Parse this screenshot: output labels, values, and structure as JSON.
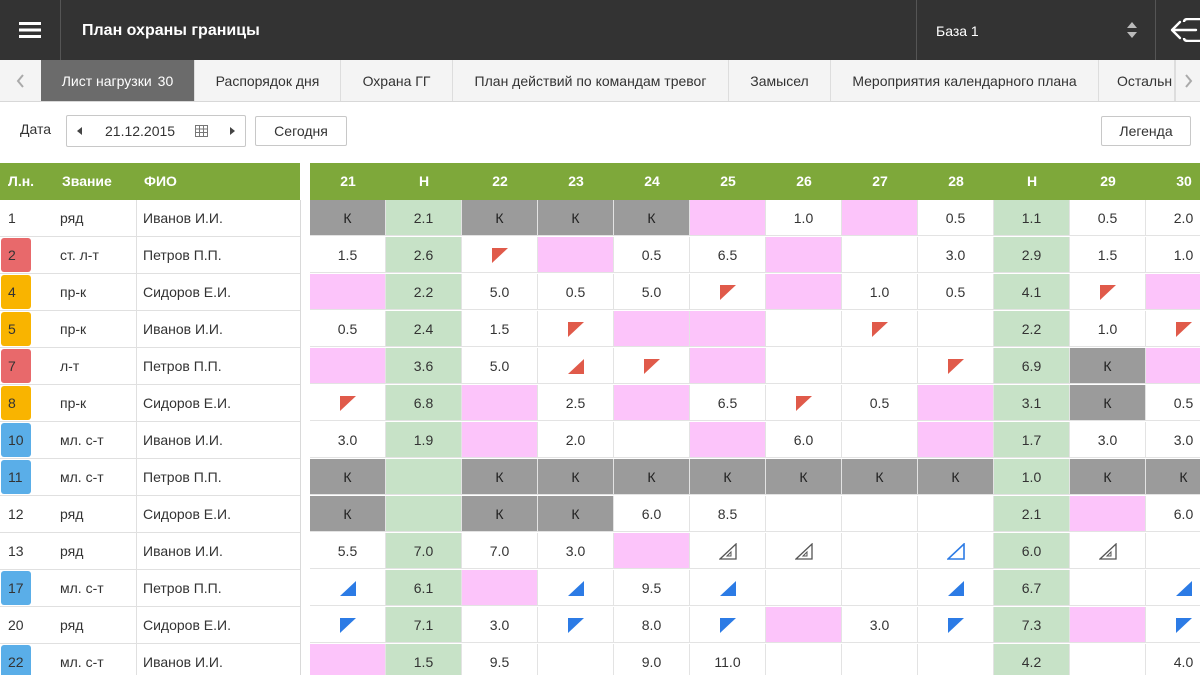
{
  "header": {
    "title": "План охраны границы",
    "base_value": "База 1",
    "icons": {
      "menu": "hamburger-menu-icon",
      "base_arrows": "sort-arrows-icon",
      "logout": "logout-icon"
    }
  },
  "tabs": [
    {
      "label": "Лист нагрузки",
      "count": "30",
      "active": true
    },
    {
      "label": "Распорядок дня"
    },
    {
      "label": "Охрана ГГ"
    },
    {
      "label": "План действий по командам тревог"
    },
    {
      "label": "Замысел"
    },
    {
      "label": "Мероприятия календарного плана"
    },
    {
      "label": "Остальн"
    }
  ],
  "toolbar": {
    "date_label": "Дата",
    "date_value": "21.12.2015",
    "today_label": "Сегодня",
    "legend_label": "Легенда"
  },
  "colors": {
    "header_bg": "#333333",
    "table_header": "#7ea83a",
    "off_cell": "#9b9b9b",
    "pink_cell": "#fcc4fa",
    "holiday_col": "#c7e2c7",
    "red_badge": "#e8696b",
    "orange_badge": "#f9b400",
    "blue_badge": "#5aaee8",
    "marker_red": "#e05a4a",
    "marker_blue": "#2c7be5"
  },
  "table": {
    "columns": {
      "ln": "Л.н.",
      "rank": "Звание",
      "fio": "ФИО"
    },
    "days": [
      "21",
      "Н",
      "22",
      "23",
      "24",
      "25",
      "26",
      "27",
      "28",
      "Н",
      "29",
      "30"
    ],
    "rows": [
      {
        "ln": "1",
        "badge": "",
        "rank": "ряд",
        "fio": "Иванов И.И.",
        "cells": [
          [
            "k",
            "К"
          ],
          [
            "g",
            "2.1"
          ],
          [
            "k",
            "К"
          ],
          [
            "k",
            "К"
          ],
          [
            "k",
            "К"
          ],
          [
            "p",
            ""
          ],
          [
            "w",
            "1.0"
          ],
          [
            "p",
            ""
          ],
          [
            "w",
            "0.5"
          ],
          [
            "g",
            "1.1"
          ],
          [
            "w",
            "0.5"
          ],
          [
            "w",
            "2.0"
          ]
        ]
      },
      {
        "ln": "2",
        "badge": "red",
        "rank": "ст. л-т",
        "fio": "Петров П.П.",
        "cells": [
          [
            "w",
            "1.5"
          ],
          [
            "g",
            "2.6"
          ],
          [
            "w",
            "",
            "tl-red"
          ],
          [
            "p",
            ""
          ],
          [
            "w",
            "0.5"
          ],
          [
            "w",
            "6.5"
          ],
          [
            "p",
            ""
          ],
          [
            "w",
            ""
          ],
          [
            "w",
            "3.0"
          ],
          [
            "g",
            "2.9"
          ],
          [
            "w",
            "1.5"
          ],
          [
            "w",
            "1.0"
          ]
        ]
      },
      {
        "ln": "4",
        "badge": "orange",
        "rank": "пр-к",
        "fio": "Сидоров Е.И.",
        "cells": [
          [
            "p",
            ""
          ],
          [
            "g",
            "2.2"
          ],
          [
            "w",
            "5.0"
          ],
          [
            "w",
            "0.5"
          ],
          [
            "w",
            "5.0"
          ],
          [
            "w",
            "",
            "tl-red"
          ],
          [
            "p",
            ""
          ],
          [
            "w",
            "1.0"
          ],
          [
            "w",
            "0.5"
          ],
          [
            "g",
            "4.1"
          ],
          [
            "w",
            "",
            "tl-red"
          ],
          [
            "p",
            ""
          ]
        ]
      },
      {
        "ln": "5",
        "badge": "orange",
        "rank": "пр-к",
        "fio": "Иванов И.И.",
        "cells": [
          [
            "w",
            "0.5"
          ],
          [
            "g",
            "2.4"
          ],
          [
            "w",
            "1.5"
          ],
          [
            "w",
            "",
            "tl-red"
          ],
          [
            "p",
            ""
          ],
          [
            "p",
            ""
          ],
          [
            "w",
            ""
          ],
          [
            "w",
            "",
            "tl-red"
          ],
          [
            "w",
            ""
          ],
          [
            "g",
            "2.2"
          ],
          [
            "w",
            "1.0"
          ],
          [
            "w",
            "",
            "tl-red"
          ]
        ]
      },
      {
        "ln": "7",
        "badge": "red",
        "rank": "л-т",
        "fio": "Петров П.П.",
        "cells": [
          [
            "p",
            ""
          ],
          [
            "g",
            "3.6"
          ],
          [
            "w",
            "5.0"
          ],
          [
            "w",
            "",
            "br-red"
          ],
          [
            "w",
            "",
            "tl-red"
          ],
          [
            "p",
            ""
          ],
          [
            "w",
            ""
          ],
          [
            "w",
            ""
          ],
          [
            "w",
            "",
            "tl-red"
          ],
          [
            "g",
            "6.9"
          ],
          [
            "k",
            "К"
          ],
          [
            "p",
            ""
          ]
        ]
      },
      {
        "ln": "8",
        "badge": "orange",
        "rank": "пр-к",
        "fio": "Сидоров Е.И.",
        "cells": [
          [
            "w",
            "",
            "tl-red"
          ],
          [
            "g",
            "6.8"
          ],
          [
            "p",
            ""
          ],
          [
            "w",
            "2.5"
          ],
          [
            "p",
            ""
          ],
          [
            "w",
            "6.5"
          ],
          [
            "w",
            "",
            "tl-red"
          ],
          [
            "w",
            "0.5"
          ],
          [
            "p",
            ""
          ],
          [
            "g",
            "3.1"
          ],
          [
            "k",
            "К"
          ],
          [
            "w",
            "0.5"
          ]
        ]
      },
      {
        "ln": "10",
        "badge": "blue",
        "rank": "мл. с-т",
        "fio": "Иванов И.И.",
        "cells": [
          [
            "w",
            "3.0"
          ],
          [
            "g",
            "1.9"
          ],
          [
            "p",
            ""
          ],
          [
            "w",
            "2.0"
          ],
          [
            "w",
            ""
          ],
          [
            "p",
            ""
          ],
          [
            "w",
            "6.0"
          ],
          [
            "w",
            ""
          ],
          [
            "p",
            ""
          ],
          [
            "g",
            "1.7"
          ],
          [
            "w",
            "3.0"
          ],
          [
            "w",
            "3.0"
          ]
        ]
      },
      {
        "ln": "11",
        "badge": "blue",
        "rank": "мл. с-т",
        "fio": "Петров П.П.",
        "cells": [
          [
            "k",
            "К"
          ],
          [
            "g",
            ""
          ],
          [
            "k",
            "К"
          ],
          [
            "k",
            "К"
          ],
          [
            "k",
            "К"
          ],
          [
            "k",
            "К"
          ],
          [
            "k",
            "К"
          ],
          [
            "k",
            "К"
          ],
          [
            "k",
            "К"
          ],
          [
            "g",
            "1.0"
          ],
          [
            "k",
            "К"
          ],
          [
            "k",
            "К"
          ]
        ]
      },
      {
        "ln": "12",
        "badge": "",
        "rank": "ряд",
        "fio": "Сидоров Е.И.",
        "cells": [
          [
            "k",
            "К"
          ],
          [
            "g",
            ""
          ],
          [
            "k",
            "К"
          ],
          [
            "k",
            "К"
          ],
          [
            "w",
            "6.0"
          ],
          [
            "w",
            "8.5"
          ],
          [
            "w",
            ""
          ],
          [
            "w",
            ""
          ],
          [
            "w",
            ""
          ],
          [
            "g",
            "2.1"
          ],
          [
            "p",
            ""
          ],
          [
            "w",
            "6.0"
          ]
        ]
      },
      {
        "ln": "13",
        "badge": "",
        "rank": "ряд",
        "fio": "Иванов И.И.",
        "cells": [
          [
            "w",
            "5.5"
          ],
          [
            "g",
            "7.0"
          ],
          [
            "w",
            "7.0"
          ],
          [
            "w",
            "3.0"
          ],
          [
            "p",
            ""
          ],
          [
            "w",
            "",
            "br-outline"
          ],
          [
            "w",
            "",
            "br-outline"
          ],
          [
            "w",
            ""
          ],
          [
            "w",
            "",
            "br-blue-outline"
          ],
          [
            "g",
            "6.0"
          ],
          [
            "w",
            "",
            "br-outline"
          ],
          [
            "w",
            ""
          ]
        ]
      },
      {
        "ln": "17",
        "badge": "blue",
        "rank": "мл. с-т",
        "fio": "Петров П.П.",
        "cells": [
          [
            "w",
            "",
            "br-blue"
          ],
          [
            "g",
            "6.1"
          ],
          [
            "p",
            ""
          ],
          [
            "w",
            "",
            "br-blue"
          ],
          [
            "w",
            "9.5"
          ],
          [
            "w",
            "",
            "br-blue"
          ],
          [
            "w",
            ""
          ],
          [
            "w",
            ""
          ],
          [
            "w",
            "",
            "br-blue"
          ],
          [
            "g",
            "6.7"
          ],
          [
            "w",
            ""
          ],
          [
            "w",
            "",
            "br-blue"
          ]
        ]
      },
      {
        "ln": "20",
        "badge": "",
        "rank": "ряд",
        "fio": "Сидоров Е.И.",
        "cells": [
          [
            "w",
            "",
            "tl-blue"
          ],
          [
            "g",
            "7.1"
          ],
          [
            "w",
            "3.0"
          ],
          [
            "w",
            "",
            "tl-blue"
          ],
          [
            "w",
            "8.0"
          ],
          [
            "w",
            "",
            "tl-blue"
          ],
          [
            "p",
            ""
          ],
          [
            "w",
            "3.0"
          ],
          [
            "w",
            "",
            "tl-blue"
          ],
          [
            "g",
            "7.3"
          ],
          [
            "p",
            ""
          ],
          [
            "w",
            "",
            "tl-blue"
          ]
        ]
      },
      {
        "ln": "22",
        "badge": "blue",
        "rank": "мл. с-т",
        "fio": "Иванов И.И.",
        "cells": [
          [
            "p",
            ""
          ],
          [
            "g",
            "1.5"
          ],
          [
            "w",
            "9.5"
          ],
          [
            "w",
            ""
          ],
          [
            "w",
            "9.0"
          ],
          [
            "w",
            "11.0"
          ],
          [
            "w",
            ""
          ],
          [
            "w",
            ""
          ],
          [
            "w",
            ""
          ],
          [
            "g",
            "4.2"
          ],
          [
            "w",
            ""
          ],
          [
            "w",
            "4.0"
          ]
        ]
      }
    ]
  }
}
